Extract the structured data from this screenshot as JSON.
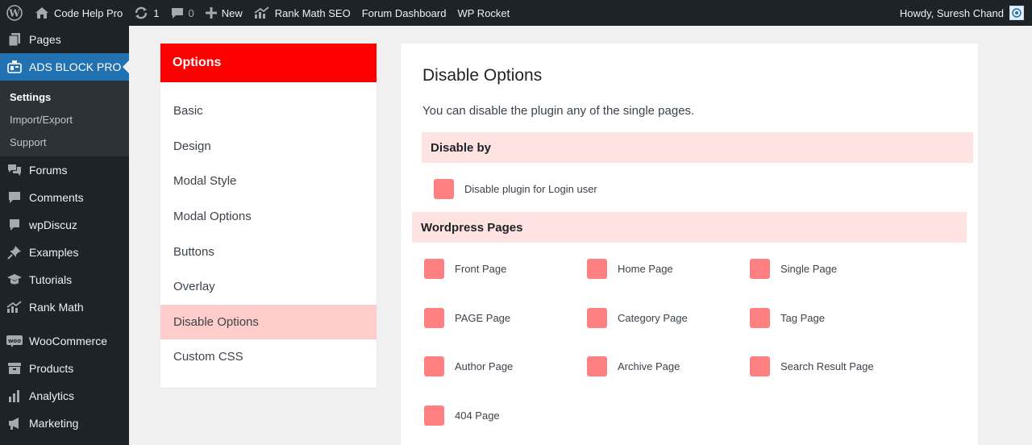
{
  "admin_bar": {
    "site_name": "Code Help Pro",
    "updates_count": "1",
    "comments_count": "0",
    "new_label": "New",
    "rank_math_label": "Rank Math SEO",
    "forum_label": "Forum Dashboard",
    "rocket_label": "WP Rocket",
    "greeting": "Howdy, Suresh Chand"
  },
  "sidebar": {
    "pages": "Pages",
    "ads_block_pro": "ADS BLOCK PRO",
    "submenu": [
      "Settings",
      "Import/Export",
      "Support"
    ],
    "items": [
      "Forums",
      "Comments",
      "wpDiscuz",
      "Examples",
      "Tutorials",
      "Rank Math"
    ],
    "items2": [
      "WooCommerce",
      "Products",
      "Analytics",
      "Marketing"
    ]
  },
  "options": {
    "header": "Options",
    "items": [
      "Basic",
      "Design",
      "Modal Style",
      "Modal Options",
      "Buttons",
      "Overlay",
      "Disable Options",
      "Custom CSS"
    ]
  },
  "content": {
    "title": "Disable Options",
    "description": "You can disable the plugin any of the single pages.",
    "section1": "Disable by",
    "login_option": "Disable plugin for Login user",
    "section2": "Wordpress Pages",
    "pages": [
      "Front Page",
      "Home Page",
      "Single Page",
      "PAGE Page",
      "Category Page",
      "Tag Page",
      "Author Page",
      "Archive Page",
      "Search Result Page",
      "404 Page"
    ]
  },
  "colors": {
    "accent_red": "#ff0000",
    "selected_bg": "#ffcccc",
    "checkbox": "#ff8080",
    "section_bar": "#ffe2e2",
    "wp_blue": "#2271b1"
  }
}
